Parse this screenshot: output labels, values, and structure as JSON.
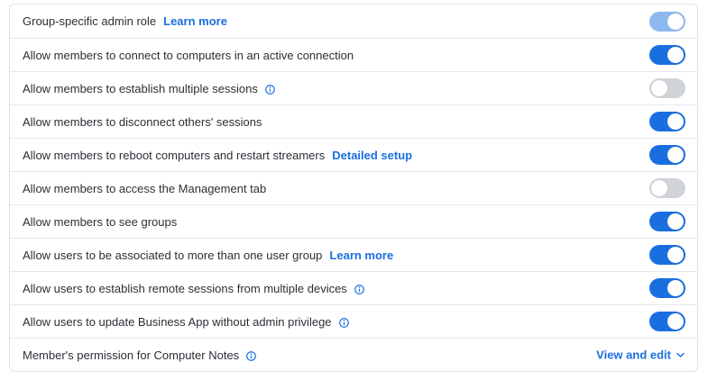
{
  "settings": [
    {
      "label": "Group-specific admin role",
      "link": "Learn more",
      "info": false,
      "toggle": "on-disabled"
    },
    {
      "label": "Allow members to connect to computers in an active connection",
      "link": "",
      "info": false,
      "toggle": "on"
    },
    {
      "label": "Allow members to establish multiple sessions",
      "link": "",
      "info": true,
      "toggle": "off"
    },
    {
      "label": "Allow members to disconnect others' sessions",
      "link": "",
      "info": false,
      "toggle": "on"
    },
    {
      "label": "Allow members to reboot computers and restart streamers",
      "link": "Detailed setup",
      "info": false,
      "toggle": "on"
    },
    {
      "label": "Allow members to access the Management tab",
      "link": "",
      "info": false,
      "toggle": "off"
    },
    {
      "label": "Allow members to see groups",
      "link": "",
      "info": false,
      "toggle": "on"
    },
    {
      "label": "Allow users to be associated to more than one user group",
      "link": "Learn more",
      "info": false,
      "toggle": "on"
    },
    {
      "label": "Allow users to establish remote sessions from multiple devices",
      "link": "",
      "info": true,
      "toggle": "on"
    },
    {
      "label": "Allow users to update Business App without admin privilege",
      "link": "",
      "info": true,
      "toggle": "on"
    }
  ],
  "notes_row": {
    "label": "Member's permission for Computer Notes",
    "info": true,
    "action_label": "View and edit",
    "action_icon": "chevron-down-icon"
  },
  "colors": {
    "accent": "#1a6fe0",
    "toggle_off": "#d0d3d8",
    "toggle_disabled": "#8db8f0",
    "text": "#2b2f36",
    "border": "#e6e8ec"
  }
}
